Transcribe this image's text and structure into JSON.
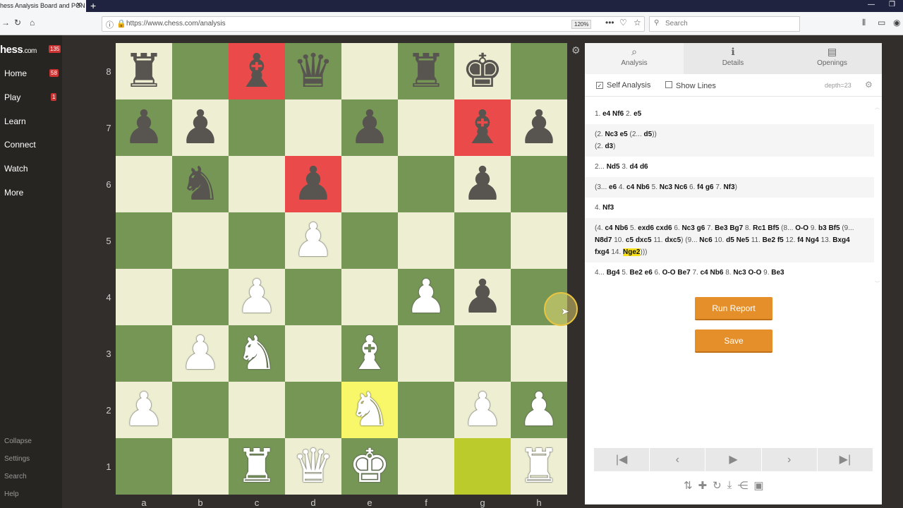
{
  "browser": {
    "tab_title": "hess Analysis Board and PGN",
    "url": "https://www.chess.com/analysis",
    "zoom": "120%",
    "search_placeholder": "Search"
  },
  "sidebar": {
    "logo": "hess",
    "logo_suffix": ".com",
    "logo_badge": "135",
    "items": [
      {
        "label": "Home",
        "badge": "58"
      },
      {
        "label": "Play",
        "badge": "1"
      },
      {
        "label": "Learn"
      },
      {
        "label": "Connect"
      },
      {
        "label": "Watch"
      },
      {
        "label": "More"
      }
    ],
    "bottom": [
      "Collapse",
      "Settings",
      "Search",
      "Help"
    ]
  },
  "board": {
    "ranks": [
      "8",
      "7",
      "6",
      "5",
      "4",
      "3",
      "2",
      "1"
    ],
    "files": [
      "a",
      "b",
      "c",
      "d",
      "e",
      "f",
      "g",
      "h"
    ],
    "position": [
      [
        "r",
        "",
        "b",
        "q",
        "",
        "r",
        "k",
        ""
      ],
      [
        "p",
        "p",
        "",
        "",
        "p",
        "",
        "b",
        "p"
      ],
      [
        "",
        "n",
        "",
        "p",
        "",
        "",
        "p",
        ""
      ],
      [
        "",
        "",
        "",
        "P",
        "",
        "",
        "",
        ""
      ],
      [
        "",
        "",
        "P",
        "",
        "",
        "P",
        "p",
        ""
      ],
      [
        "",
        "P",
        "N",
        "",
        "B",
        "",
        "",
        ""
      ],
      [
        "P",
        "",
        "",
        "",
        "N",
        "",
        "P",
        "P"
      ],
      [
        "",
        "",
        "R",
        "Q",
        "K",
        "",
        "",
        "R"
      ]
    ],
    "highlights": {
      "red": [
        "c8",
        "g7",
        "d6"
      ],
      "yellow": [
        "e2"
      ],
      "last_move": [
        "g1"
      ]
    },
    "colors": {
      "light": "#eeeed2",
      "dark": "#769656",
      "red": "#eb4a4a"
    }
  },
  "panel": {
    "tabs": [
      {
        "label": "Analysis",
        "icon": "analysis-icon"
      },
      {
        "label": "Details",
        "icon": "info-icon"
      },
      {
        "label": "Openings",
        "icon": "book-icon"
      }
    ],
    "self_analysis": "Self Analysis",
    "self_analysis_checked": true,
    "show_lines": "Show Lines",
    "show_lines_checked": false,
    "depth": "depth=23",
    "moves": [
      {
        "type": "main",
        "tokens": [
          [
            "n",
            "1."
          ],
          [
            "m",
            "e4"
          ],
          [
            "m",
            "Nf6"
          ],
          [
            "n",
            "2."
          ],
          [
            "m",
            "e5"
          ]
        ]
      },
      {
        "type": "var",
        "tokens": [
          [
            "n",
            "(2."
          ],
          [
            "m",
            "Nc3"
          ],
          [
            "m",
            "e5"
          ],
          [
            "n",
            "(2..."
          ],
          [
            "m",
            "d5"
          ],
          [
            "n",
            "))"
          ],
          [
            "br",
            ""
          ],
          [
            "n",
            "(2."
          ],
          [
            "m",
            "d3"
          ],
          [
            "n",
            ")"
          ]
        ]
      },
      {
        "type": "main",
        "tokens": [
          [
            "n",
            "2..."
          ],
          [
            "m",
            "Nd5"
          ],
          [
            "n",
            "3."
          ],
          [
            "m",
            "d4"
          ],
          [
            "m",
            "d6"
          ]
        ]
      },
      {
        "type": "var",
        "tokens": [
          [
            "n",
            "(3..."
          ],
          [
            "m",
            "e6"
          ],
          [
            "n",
            "4."
          ],
          [
            "m",
            "c4"
          ],
          [
            "m",
            "Nb6"
          ],
          [
            "n",
            "5."
          ],
          [
            "m",
            "Nc3"
          ],
          [
            "m",
            "Nc6"
          ],
          [
            "n",
            "6."
          ],
          [
            "m",
            "f4"
          ],
          [
            "m",
            "g6"
          ],
          [
            "n",
            "7."
          ],
          [
            "m",
            "Nf3"
          ],
          [
            "n",
            ")"
          ]
        ]
      },
      {
        "type": "main",
        "tokens": [
          [
            "n",
            "4."
          ],
          [
            "m",
            "Nf3"
          ]
        ]
      },
      {
        "type": "var",
        "tokens": [
          [
            "n",
            "(4."
          ],
          [
            "m",
            "c4"
          ],
          [
            "m",
            "Nb6"
          ],
          [
            "n",
            "5."
          ],
          [
            "m",
            "exd6"
          ],
          [
            "m",
            "cxd6"
          ],
          [
            "n",
            "6."
          ],
          [
            "m",
            "Nc3"
          ],
          [
            "m",
            "g6"
          ],
          [
            "n",
            "7."
          ],
          [
            "m",
            "Be3"
          ],
          [
            "m",
            "Bg7"
          ],
          [
            "n",
            "8."
          ],
          [
            "m",
            "Rc1"
          ],
          [
            "m",
            "Bf5"
          ],
          [
            "n",
            "(8..."
          ],
          [
            "m",
            "O-O"
          ],
          [
            "n",
            "9."
          ],
          [
            "m",
            "b3"
          ],
          [
            "m",
            "Bf5"
          ],
          [
            "n",
            "(9..."
          ],
          [
            "m",
            "N8d7"
          ],
          [
            "n",
            "10."
          ],
          [
            "m",
            "c5"
          ],
          [
            "m",
            "dxc5"
          ],
          [
            "n",
            "11."
          ],
          [
            "m",
            "dxc5"
          ],
          [
            "n",
            ")"
          ],
          [
            "n",
            "(9..."
          ],
          [
            "m",
            "Nc6"
          ],
          [
            "n",
            "10."
          ],
          [
            "m",
            "d5"
          ],
          [
            "m",
            "Ne5"
          ],
          [
            "n",
            "11."
          ],
          [
            "m",
            "Be2"
          ],
          [
            "m",
            "f5"
          ],
          [
            "n",
            "12."
          ],
          [
            "m",
            "f4"
          ],
          [
            "m",
            "Ng4"
          ],
          [
            "n",
            "13."
          ],
          [
            "m",
            "Bxg4"
          ],
          [
            "m",
            "fxg4"
          ],
          [
            "n",
            "14."
          ],
          [
            "h",
            "Nge2"
          ],
          [
            "n",
            ")))"
          ]
        ]
      },
      {
        "type": "main",
        "tokens": [
          [
            "n",
            "4..."
          ],
          [
            "m",
            "Bg4"
          ],
          [
            "n",
            "5."
          ],
          [
            "m",
            "Be2"
          ],
          [
            "m",
            "e6"
          ],
          [
            "n",
            "6."
          ],
          [
            "m",
            "O-O"
          ],
          [
            "m",
            "Be7"
          ],
          [
            "n",
            "7."
          ],
          [
            "m",
            "c4"
          ],
          [
            "m",
            "Nb6"
          ],
          [
            "n",
            "8."
          ],
          [
            "m",
            "Nc3"
          ],
          [
            "m",
            "O-O"
          ],
          [
            "n",
            "9."
          ],
          [
            "m",
            "Be3"
          ]
        ]
      }
    ],
    "run_report": "Run Report",
    "save": "Save",
    "accent": "#e58f2a"
  }
}
